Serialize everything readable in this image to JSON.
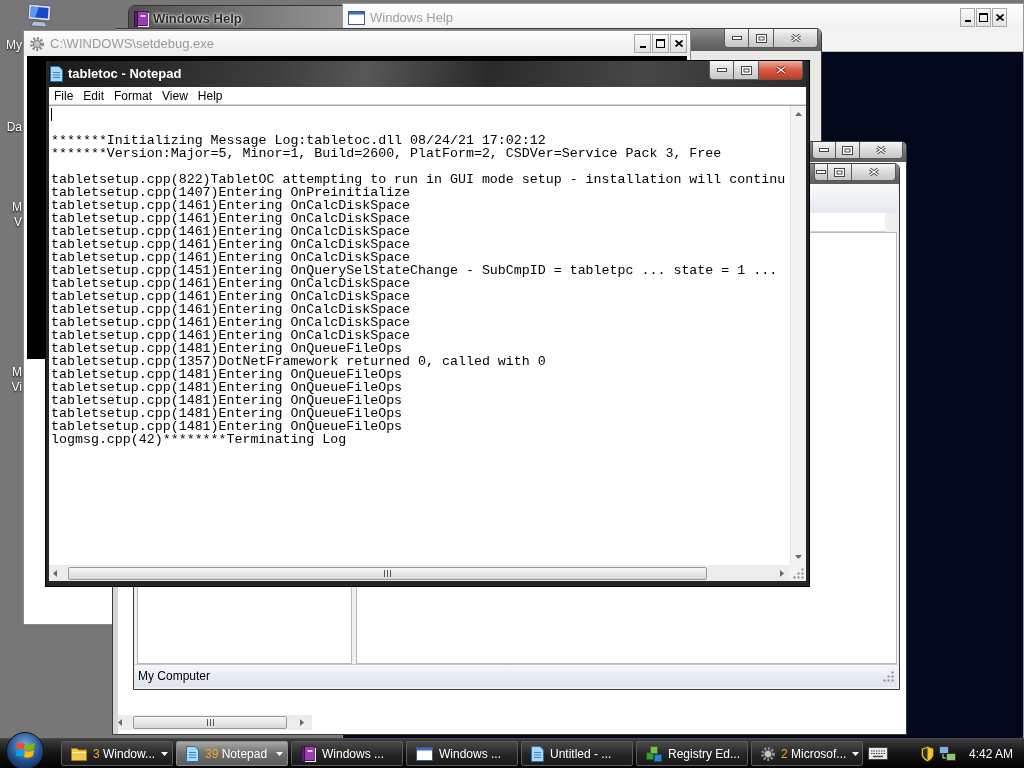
{
  "desktop": {
    "icons": [
      {
        "lines": [
          "My"
        ]
      },
      {
        "lines": [
          "Da"
        ]
      },
      {
        "lines": [
          "M",
          "V"
        ]
      },
      {
        "lines": [
          "M",
          "Vi"
        ]
      }
    ]
  },
  "windows": [
    {
      "kind": "help-book",
      "title": "Windows Help",
      "active": false
    },
    {
      "kind": "help-window",
      "title": "Windows Help",
      "active": false
    },
    {
      "kind": "frame",
      "active": false
    },
    {
      "kind": "console",
      "title": "C:\\WINDOWS\\setdebug.exe",
      "active": false
    },
    {
      "kind": "frame-scroll",
      "active": false
    },
    {
      "kind": "explorer",
      "active": false,
      "status": "My Computer"
    },
    {
      "kind": "notepad",
      "title": "tabletoc - Notepad",
      "active": true,
      "menu": [
        "File",
        "Edit",
        "Format",
        "View",
        "Help"
      ],
      "cursor": true,
      "blocks": [
        [
          "*******Initializing Message Log:tabletoc.dll 08/24/21 17:02:12",
          "*******Version:Major=5, Minor=1, Build=2600, PlatForm=2, CSDVer=Service Pack 3, Free"
        ],
        [
          "tabletsetup.cpp(822)TabletOC attempting to run in GUI mode setup - installation will continu",
          "tabletsetup.cpp(1407)Entering OnPreinitialize",
          "tabletsetup.cpp(1461)Entering OnCalcDiskSpace",
          "tabletsetup.cpp(1461)Entering OnCalcDiskSpace",
          "tabletsetup.cpp(1461)Entering OnCalcDiskSpace",
          "tabletsetup.cpp(1461)Entering OnCalcDiskSpace",
          "tabletsetup.cpp(1461)Entering OnCalcDiskSpace",
          "tabletsetup.cpp(1451)Entering OnQuerySelStateChange - SubCmpID = tabletpc ... state = 1 ...",
          "tabletsetup.cpp(1461)Entering OnCalcDiskSpace",
          "tabletsetup.cpp(1461)Entering OnCalcDiskSpace",
          "tabletsetup.cpp(1461)Entering OnCalcDiskSpace",
          "tabletsetup.cpp(1461)Entering OnCalcDiskSpace",
          "tabletsetup.cpp(1461)Entering OnCalcDiskSpace",
          "tabletsetup.cpp(1481)Entering OnQueueFileOps",
          "tabletsetup.cpp(1357)DotNetFramework returned 0, called with 0",
          "tabletsetup.cpp(1481)Entering OnQueueFileOps",
          "tabletsetup.cpp(1481)Entering OnQueueFileOps",
          "tabletsetup.cpp(1481)Entering OnQueueFileOps",
          "tabletsetup.cpp(1481)Entering OnQueueFileOps",
          "tabletsetup.cpp(1481)Entering OnQueueFileOps",
          "logmsg.cpp(42)********Terminating Log"
        ]
      ]
    }
  ],
  "taskbar": {
    "buttons": [
      {
        "kind": "explorer",
        "count": "3",
        "label": "Window...",
        "grouped": true,
        "selected": false
      },
      {
        "kind": "notepad",
        "count": "39",
        "label": "Notepad",
        "grouped": true,
        "selected": true
      },
      {
        "kind": "help",
        "label": "Windows ...",
        "grouped": false,
        "selected": false
      },
      {
        "kind": "help-window",
        "label": "Windows ...",
        "grouped": false,
        "selected": false
      },
      {
        "kind": "notepad",
        "label": "Untitled - ...",
        "grouped": false,
        "selected": false
      },
      {
        "kind": "regedit",
        "label": "Registry Ed...",
        "grouped": false,
        "selected": false
      },
      {
        "kind": "console",
        "count": "2",
        "label": "Microsof...",
        "grouped": true,
        "selected": false
      }
    ],
    "clock": "4:42 AM"
  }
}
